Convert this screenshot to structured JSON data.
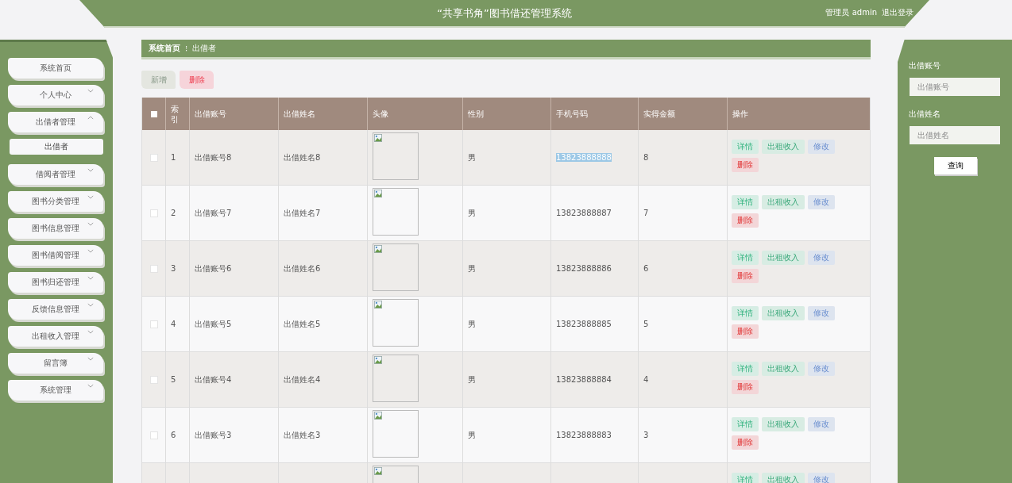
{
  "header": {
    "title": "“共享书角”图书借还管理系统",
    "user": "管理员 admin",
    "logout": "退出登录"
  },
  "sidebar": {
    "items": [
      {
        "label": "系统首页"
      },
      {
        "label": "个人中心",
        "expanded": false
      },
      {
        "label": "出借者管理",
        "expanded": true,
        "children": [
          {
            "label": "出借者"
          }
        ]
      },
      {
        "label": "借阅者管理",
        "expanded": false
      },
      {
        "label": "图书分类管理",
        "expanded": false
      },
      {
        "label": "图书信息管理",
        "expanded": false
      },
      {
        "label": "图书借阅管理",
        "expanded": false
      },
      {
        "label": "图书归还管理",
        "expanded": false
      },
      {
        "label": "反馈信息管理",
        "expanded": false
      },
      {
        "label": "出租收入管理",
        "expanded": false
      },
      {
        "label": "留言簿",
        "expanded": false
      },
      {
        "label": "系统管理",
        "expanded": false
      }
    ]
  },
  "breadcrumb": [
    "系统首页",
    "出借者"
  ],
  "breadcrumb_separator": "⁝",
  "toolbar": [
    {
      "label": "新增",
      "kind": "add"
    },
    {
      "label": "删除",
      "kind": "delete"
    }
  ],
  "table": {
    "select_all": {
      "checked": false
    },
    "columns": [
      "索引",
      "出借账号",
      "出借姓名",
      "头像",
      "性别",
      "手机号码",
      "实得金额",
      "操作"
    ],
    "rows": [
      {
        "checked": false,
        "index": "1",
        "account": "出借账号8",
        "name": "出借姓名8",
        "gender": "男",
        "phone": "13823888888",
        "phone_selected": true,
        "amount": "8",
        "actions": [
          {
            "label": "详情",
            "kind": "detail"
          },
          {
            "label": "出租收入",
            "kind": "income"
          },
          {
            "label": "修改",
            "kind": "edit"
          },
          {
            "label": "删除",
            "kind": "delete"
          }
        ]
      },
      {
        "checked": false,
        "index": "2",
        "account": "出借账号7",
        "name": "出借姓名7",
        "gender": "男",
        "phone": "13823888887",
        "phone_selected": false,
        "amount": "7",
        "actions": [
          {
            "label": "详情",
            "kind": "detail"
          },
          {
            "label": "出租收入",
            "kind": "income"
          },
          {
            "label": "修改",
            "kind": "edit"
          },
          {
            "label": "删除",
            "kind": "delete"
          }
        ]
      },
      {
        "checked": false,
        "index": "3",
        "account": "出借账号6",
        "name": "出借姓名6",
        "gender": "男",
        "phone": "13823888886",
        "phone_selected": false,
        "amount": "6",
        "actions": [
          {
            "label": "详情",
            "kind": "detail"
          },
          {
            "label": "出租收入",
            "kind": "income"
          },
          {
            "label": "修改",
            "kind": "edit"
          },
          {
            "label": "删除",
            "kind": "delete"
          }
        ]
      },
      {
        "checked": false,
        "index": "4",
        "account": "出借账号5",
        "name": "出借姓名5",
        "gender": "男",
        "phone": "13823888885",
        "phone_selected": false,
        "amount": "5",
        "actions": [
          {
            "label": "详情",
            "kind": "detail"
          },
          {
            "label": "出租收入",
            "kind": "income"
          },
          {
            "label": "修改",
            "kind": "edit"
          },
          {
            "label": "删除",
            "kind": "delete"
          }
        ]
      },
      {
        "checked": false,
        "index": "5",
        "account": "出借账号4",
        "name": "出借姓名4",
        "gender": "男",
        "phone": "13823888884",
        "phone_selected": false,
        "amount": "4",
        "actions": [
          {
            "label": "详情",
            "kind": "detail"
          },
          {
            "label": "出租收入",
            "kind": "income"
          },
          {
            "label": "修改",
            "kind": "edit"
          },
          {
            "label": "删除",
            "kind": "delete"
          }
        ]
      },
      {
        "checked": false,
        "index": "6",
        "account": "出借账号3",
        "name": "出借姓名3",
        "gender": "男",
        "phone": "13823888883",
        "phone_selected": false,
        "amount": "3",
        "actions": [
          {
            "label": "详情",
            "kind": "detail"
          },
          {
            "label": "出租收入",
            "kind": "income"
          },
          {
            "label": "修改",
            "kind": "edit"
          },
          {
            "label": "删除",
            "kind": "delete"
          }
        ]
      },
      {
        "actions": [
          {
            "label": "详情",
            "kind": "detail"
          },
          {
            "label": "出租收入",
            "kind": "income"
          },
          {
            "label": "修改",
            "kind": "edit"
          }
        ]
      }
    ]
  },
  "search": {
    "fields": [
      {
        "label": "出借账号",
        "placeholder": "出借账号"
      },
      {
        "label": "出借姓名",
        "placeholder": "出借姓名"
      }
    ],
    "button": "查询"
  }
}
